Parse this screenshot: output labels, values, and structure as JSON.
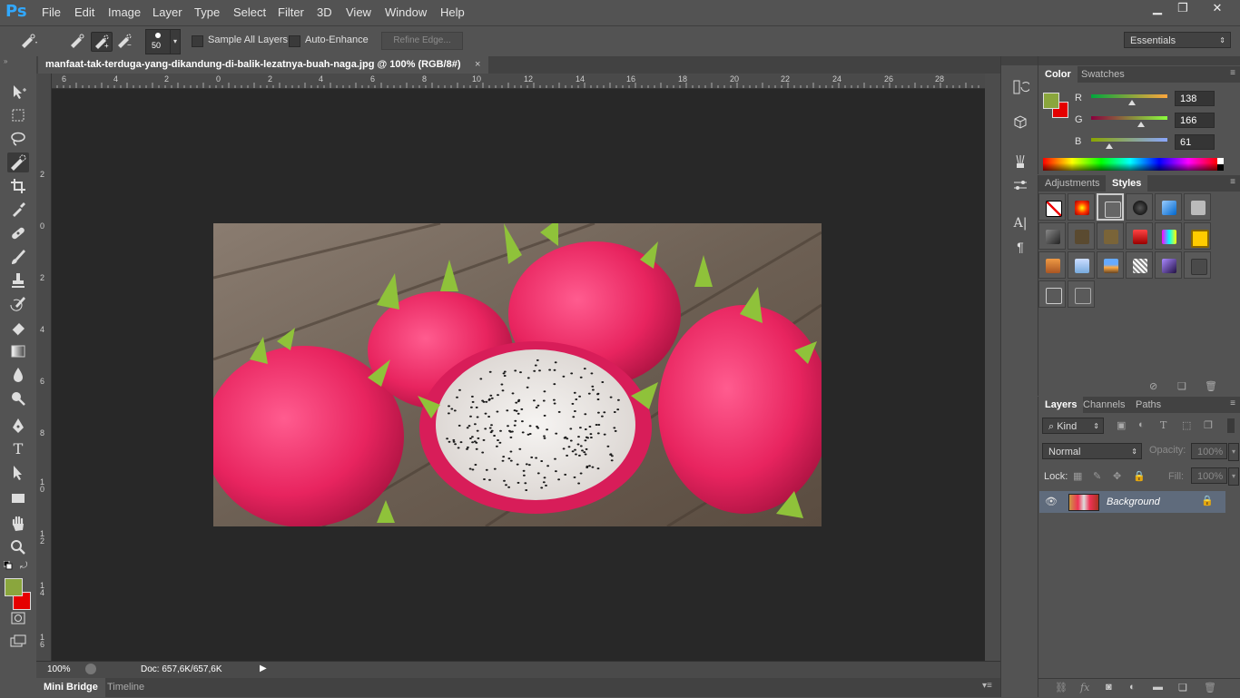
{
  "app": {
    "logo": "Ps"
  },
  "menu": [
    "File",
    "Edit",
    "Image",
    "Layer",
    "Type",
    "Select",
    "Filter",
    "3D",
    "View",
    "Window",
    "Help"
  ],
  "window_controls": {
    "minimize": "▁",
    "restore": "❐",
    "close": "✕"
  },
  "options": {
    "brush_size": "50",
    "sample_all_layers": "Sample All Layers",
    "auto_enhance": "Auto-Enhance",
    "refine_edge": "Refine Edge...",
    "workspace": "Essentials"
  },
  "document": {
    "tab_title": "manfaat-tak-terduga-yang-dikandung-di-balik-lezatnya-buah-naga.jpg @ 100% (RGB/8#)",
    "tab_close": "×",
    "zoom": "100%",
    "doc_info": "Doc: 657,6K/657,6K",
    "ruler_h": [
      "6",
      "4",
      "2",
      "0",
      "2",
      "4",
      "6",
      "8",
      "10",
      "12",
      "14",
      "16",
      "18",
      "20",
      "22",
      "24",
      "26",
      "28"
    ],
    "ruler_v": [
      "2",
      "0",
      "2",
      "4",
      "6",
      "8",
      "1 0",
      "1 2",
      "1 4",
      "1 6"
    ]
  },
  "bottom_tabs": [
    "Mini Bridge",
    "Timeline"
  ],
  "color_panel": {
    "tabs": [
      "Color",
      "Swatches"
    ],
    "channels": [
      {
        "label": "R",
        "value": "138",
        "fraction": 0.54
      },
      {
        "label": "G",
        "value": "166",
        "fraction": 0.65
      },
      {
        "label": "B",
        "value": "61",
        "fraction": 0.24
      }
    ],
    "foreground": "#8aa63d",
    "background": "#e50000"
  },
  "styles_panel": {
    "tabs": [
      "Adjustments",
      "Styles"
    ]
  },
  "layers_panel": {
    "tabs": [
      "Layers",
      "Channels",
      "Paths"
    ],
    "kind": "Kind",
    "blend_mode": "Normal",
    "opacity_label": "Opacity:",
    "opacity_value": "100%",
    "lock_label": "Lock:",
    "fill_label": "Fill:",
    "fill_value": "100%",
    "layer_name": "Background"
  }
}
